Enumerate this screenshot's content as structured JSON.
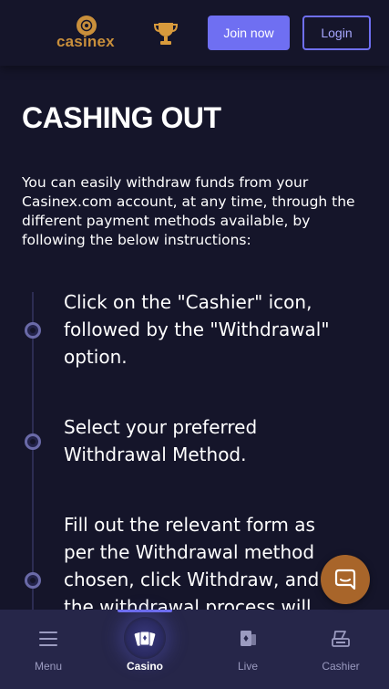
{
  "header": {
    "logo_text": "casinex",
    "join_label": "Join now",
    "login_label": "Login"
  },
  "main": {
    "title": "CASHING OUT",
    "intro": "You can easily withdraw funds from your Casinex.com account, at any time, through the different payment methods available, by following the below instructions:",
    "steps": [
      {
        "text": "Click on the \"Cashier\" icon, followed by the \"Withdrawal\" option."
      },
      {
        "text": "Select your preferred Withdrawal Method."
      },
      {
        "text": "Fill out the relevant form as per the Withdrawal method chosen, click Withdraw, and the withdrawal process will"
      }
    ]
  },
  "bottom_nav": {
    "items": [
      {
        "label": "Menu",
        "icon": "menu-icon",
        "active": false
      },
      {
        "label": "Casino",
        "icon": "casino-cards-icon",
        "active": true
      },
      {
        "label": "Live",
        "icon": "live-cards-icon",
        "active": false
      },
      {
        "label": "Cashier",
        "icon": "cashier-icon",
        "active": false
      }
    ]
  },
  "colors": {
    "background": "#15152a",
    "accent": "#6f6ff2",
    "brand_gold": "#c98f3b",
    "nav_background": "#262649",
    "chat_button": "#a8652a"
  }
}
